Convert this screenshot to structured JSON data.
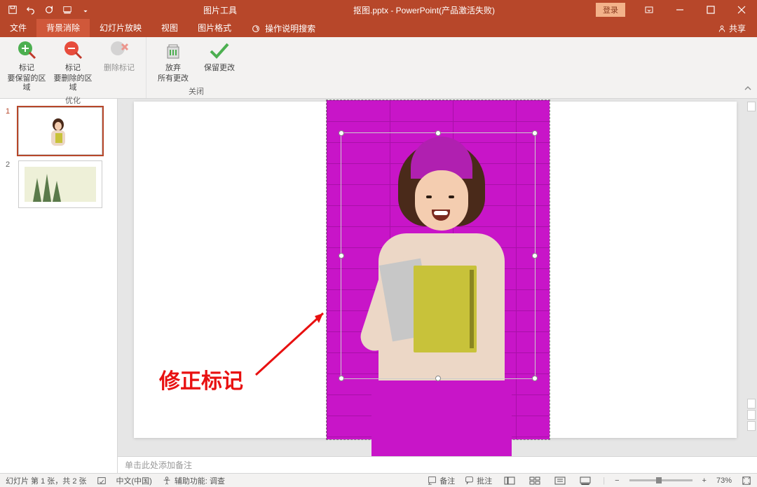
{
  "titlebar": {
    "tools_tab": "图片工具",
    "filename": "抠图.pptx  -  PowerPoint(产品激活失败)",
    "login": "登录"
  },
  "tabs": {
    "file": "文件",
    "bg_remove": "背景消除",
    "slideshow": "幻灯片放映",
    "view": "视图",
    "picture_format": "图片格式",
    "tell_me": "操作说明搜索",
    "share": "共享"
  },
  "ribbon": {
    "mark_keep_top": "标记",
    "mark_keep_bottom": "要保留的区域",
    "mark_remove_top": "标记",
    "mark_remove_bottom": "要删除的区域",
    "delete_marks": "删除标记",
    "discard_top": "放弃",
    "discard_bottom": "所有更改",
    "keep_changes": "保留更改",
    "group_refine": "优化",
    "group_close": "关闭"
  },
  "thumbs": {
    "n1": "1",
    "n2": "2"
  },
  "annotation": "修正标记",
  "notes_placeholder": "单击此处添加备注",
  "status": {
    "slide_info": "幻灯片 第 1 张，共 2 张",
    "language": "中文(中国)",
    "accessibility": "辅助功能: 调查",
    "notes_btn": "备注",
    "comments_btn": "批注",
    "zoom_value": "73%"
  }
}
